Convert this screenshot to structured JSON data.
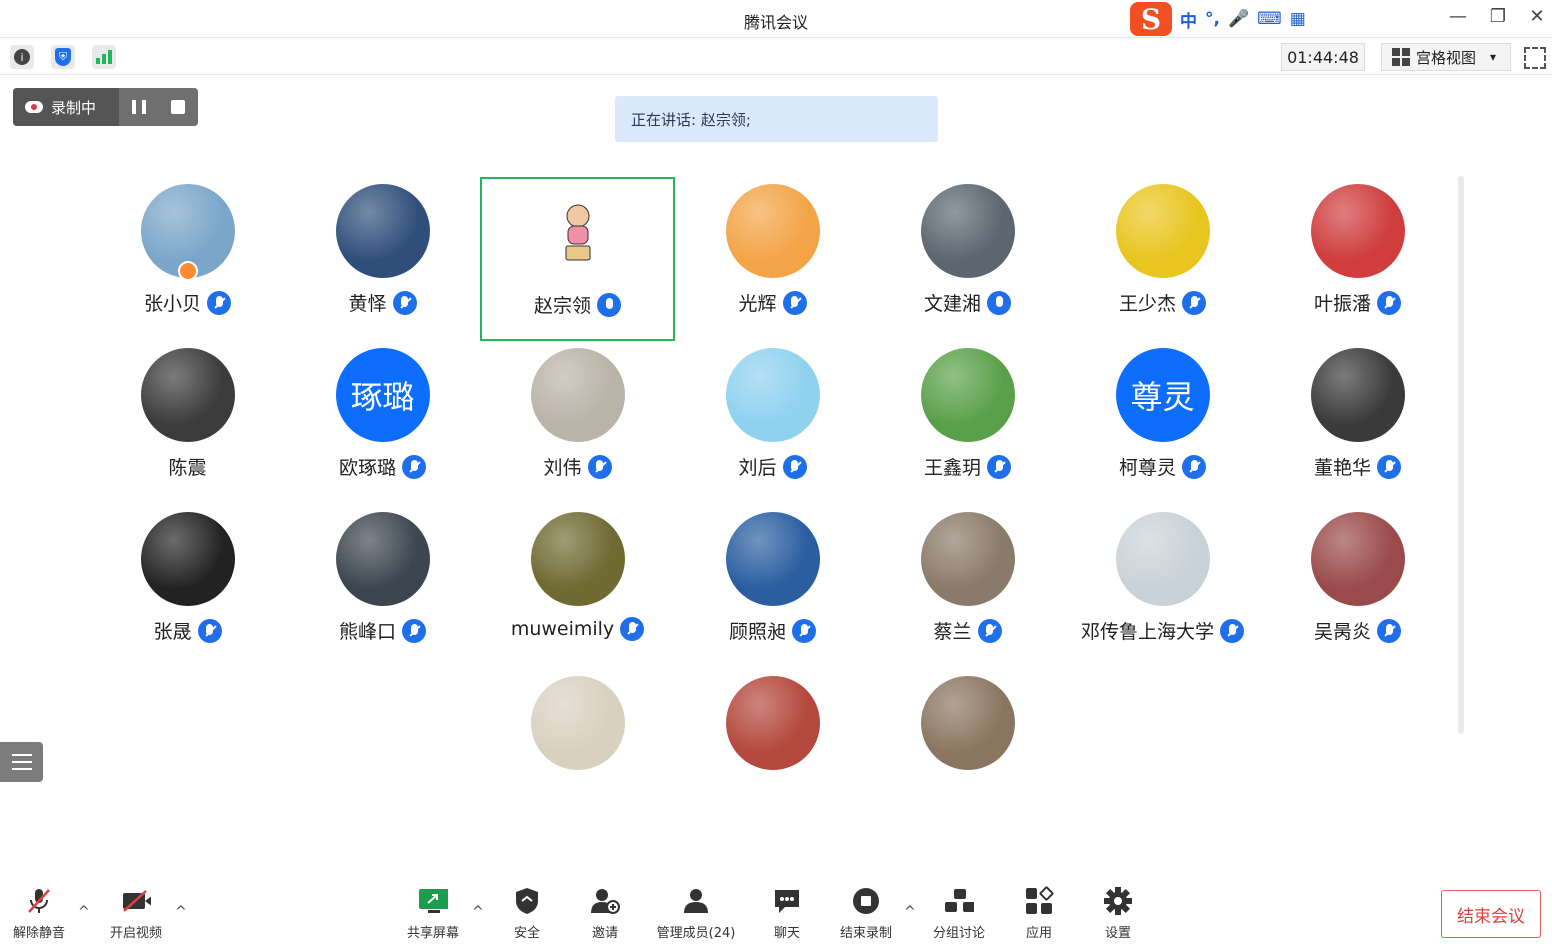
{
  "app": {
    "title": "腾讯会议"
  },
  "ime": {
    "logo": "S",
    "lang": "中",
    "punct": "°,",
    "mic": "🎤",
    "keyboard": "⌨",
    "apps": "▦"
  },
  "window": {
    "minimize": "—",
    "restore": "❐",
    "close": "✕"
  },
  "toolbar": {
    "info": "i",
    "security": "⛨",
    "signal": "▮",
    "timer": "01:44:48",
    "view_mode": "宫格视图",
    "view_caret": "▾"
  },
  "recording": {
    "label": "录制中"
  },
  "speaking": {
    "text": "正在讲话: 赵宗领;"
  },
  "participants": [
    {
      "name": "张小贝",
      "avatar": "photo",
      "color": "#7aa6c9",
      "host": true,
      "mic_on": false
    },
    {
      "name": "黄怿",
      "avatar": "photo",
      "color": "#2f4f7a",
      "mic_on": false
    },
    {
      "name": "赵宗领",
      "avatar": "photo",
      "color": "#f6f6f6",
      "mic_on": true,
      "active": true
    },
    {
      "name": "光辉",
      "avatar": "photo",
      "color": "#f3a447",
      "mic_on": false
    },
    {
      "name": "文建湘",
      "avatar": "photo",
      "color": "#5b6670",
      "mic_on": true
    },
    {
      "name": "王少杰",
      "avatar": "photo",
      "color": "#e8c51f",
      "mic_on": false
    },
    {
      "name": "叶振潘",
      "avatar": "photo",
      "color": "#cf3d3d",
      "mic_on": false
    },
    {
      "name": "陈震",
      "avatar": "photo",
      "color": "#3b3b3b",
      "mic_on": null
    },
    {
      "name": "欧琢璐",
      "avatar": "text",
      "avatar_text": "琢璐",
      "mic_on": false
    },
    {
      "name": "刘伟",
      "avatar": "photo",
      "color": "#b9b3a8",
      "mic_on": false
    },
    {
      "name": "刘后",
      "avatar": "photo",
      "color": "#8fd1ef",
      "mic_on": false
    },
    {
      "name": "王鑫玥",
      "avatar": "photo",
      "color": "#5aa04a",
      "mic_on": false
    },
    {
      "name": "柯尊灵",
      "avatar": "text",
      "avatar_text": "尊灵",
      "mic_on": false
    },
    {
      "name": "董艳华",
      "avatar": "photo",
      "color": "#3a3a3a",
      "mic_on": false
    },
    {
      "name": "张晟",
      "avatar": "photo",
      "color": "#222222",
      "mic_on": false
    },
    {
      "name": "熊峰口",
      "avatar": "photo",
      "color": "#3c4550",
      "mic_on": false
    },
    {
      "name": "muweimily",
      "avatar": "photo",
      "color": "#6f6a32",
      "mic_on": false
    },
    {
      "name": "顾照昶",
      "avatar": "photo",
      "color": "#2a5ea0",
      "mic_on": false
    },
    {
      "name": "蔡兰",
      "avatar": "photo",
      "color": "#8a7a6a",
      "mic_on": false
    },
    {
      "name": "邓传鲁上海大学",
      "avatar": "photo",
      "color": "#c9d2d8",
      "mic_on": false
    },
    {
      "name": "吴昺炎",
      "avatar": "photo",
      "color": "#9a4a4a",
      "mic_on": false
    },
    {
      "name": "",
      "avatar": "photo",
      "color": "#d9d0c0",
      "mic_on": null
    },
    {
      "name": "",
      "avatar": "photo",
      "color": "#b4483c",
      "mic_on": null
    },
    {
      "name": "",
      "avatar": "photo",
      "color": "#8a7660",
      "mic_on": null
    }
  ],
  "bottom": {
    "unmute": "解除静音",
    "video": "开启视频",
    "share": "共享屏幕",
    "security": "安全",
    "invite": "邀请",
    "members": "管理成员(24)",
    "chat": "聊天",
    "end_record": "结束录制",
    "breakout": "分组讨论",
    "apps": "应用",
    "settings": "设置",
    "end_meeting": "结束会议",
    "caret": "^"
  },
  "icons": {
    "mic_muted": "mic-muted-icon",
    "video_off": "video-off-icon",
    "share": "share-screen-icon",
    "shield": "shield-icon",
    "add_user": "add-user-icon",
    "members": "members-icon",
    "chat": "chat-icon",
    "stop": "stop-record-icon",
    "breakout": "breakout-icon",
    "apps": "apps-icon",
    "gear": "gear-icon"
  },
  "colors": {
    "accent": "#1f6feb",
    "active_border": "#21b85b",
    "danger": "#e0403f",
    "speaking_bg": "#dce8fb"
  }
}
